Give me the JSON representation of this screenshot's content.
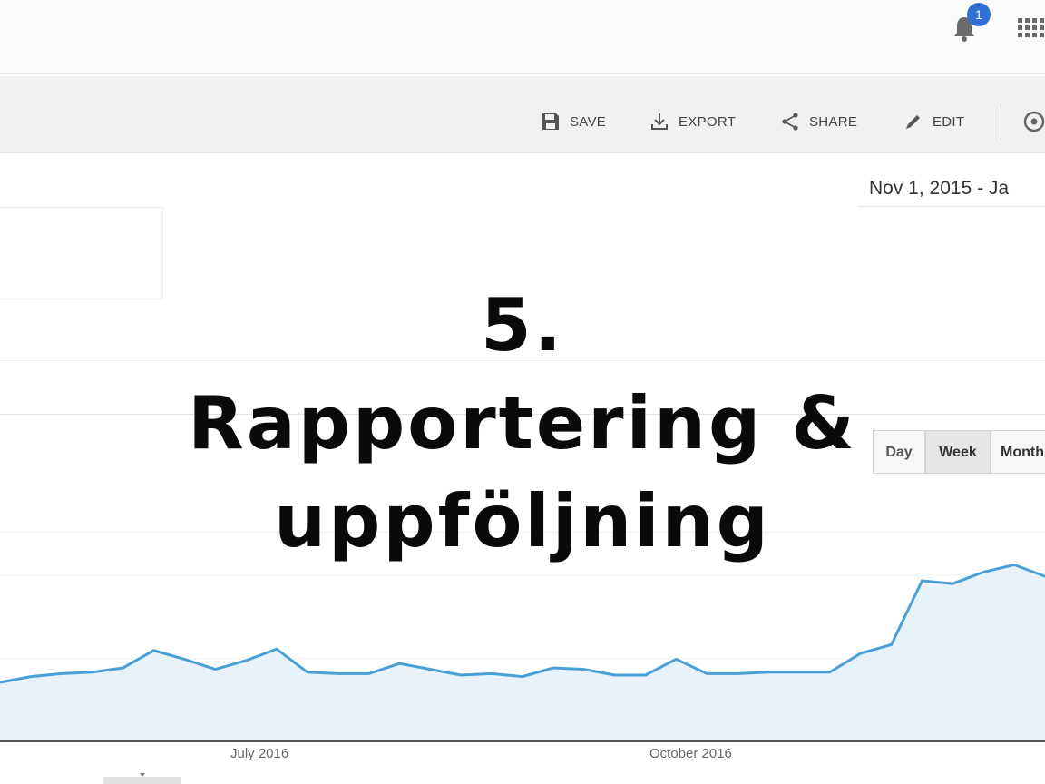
{
  "header": {
    "notification_count": "1",
    "icons": [
      "bell-icon",
      "apps-grid-icon"
    ]
  },
  "toolbar": {
    "save_label": "SAVE",
    "export_label": "EXPORT",
    "share_label": "SHARE",
    "edit_label": "EDIT"
  },
  "date_range": "Nov 1, 2015 - Ja",
  "granularity": {
    "day_label": "Day",
    "week_label": "Week",
    "month_label": "Month",
    "selected": "Week"
  },
  "overlay": {
    "line1": "5.",
    "line2": "Rapportering &",
    "line3": "uppföljning"
  },
  "chart_data": {
    "type": "area",
    "x_labels": [
      "July 2016",
      "October 2016"
    ],
    "series": [
      {
        "color": "#4a9fd6",
        "fill": "#e7f2fa",
        "values": [
          40,
          44,
          46,
          47,
          50,
          62,
          56,
          49,
          55,
          63,
          47,
          46,
          46,
          53,
          49,
          45,
          46,
          44,
          50,
          49,
          45,
          45,
          56,
          46,
          46,
          47,
          47,
          47,
          60,
          66,
          110,
          108,
          116,
          121,
          113
        ]
      }
    ],
    "ylim": [
      0,
      160
    ],
    "grid": true
  }
}
